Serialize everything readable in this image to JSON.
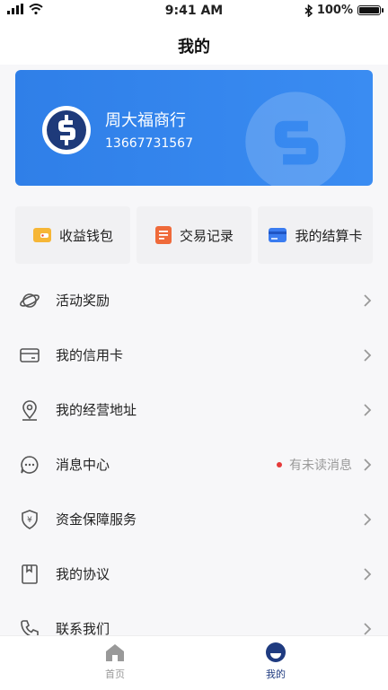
{
  "status_bar": {
    "time": "9:41 AM",
    "battery": "100%",
    "battery_level": 1.0
  },
  "header": {
    "title": "我的"
  },
  "account": {
    "name": "周大福商行",
    "phone": "13667731567"
  },
  "quick_actions": [
    {
      "label": "收益钱包",
      "icon": "wallet-icon"
    },
    {
      "label": "交易记录",
      "icon": "record-icon"
    },
    {
      "label": "我的结算卡",
      "icon": "card-icon"
    }
  ],
  "menu": [
    {
      "label": "活动奖励",
      "icon": "planet-icon"
    },
    {
      "label": "我的信用卡",
      "icon": "credit-card-icon"
    },
    {
      "label": "我的经营地址",
      "icon": "location-icon"
    },
    {
      "label": "消息中心",
      "icon": "message-icon",
      "extra": "有未读消息"
    },
    {
      "label": "资金保障服务",
      "icon": "shield-yen-icon"
    },
    {
      "label": "我的协议",
      "icon": "book-icon"
    },
    {
      "label": "联系我们",
      "icon": "phone-icon"
    }
  ],
  "tabs": [
    {
      "label": "首页",
      "icon": "home-icon",
      "active": false
    },
    {
      "label": "我的",
      "icon": "profile-icon",
      "active": true
    }
  ],
  "colors": {
    "brand_blue": "#3a8cf2",
    "tab_active": "#1f3b80",
    "unread_dot": "#e53a3a"
  }
}
